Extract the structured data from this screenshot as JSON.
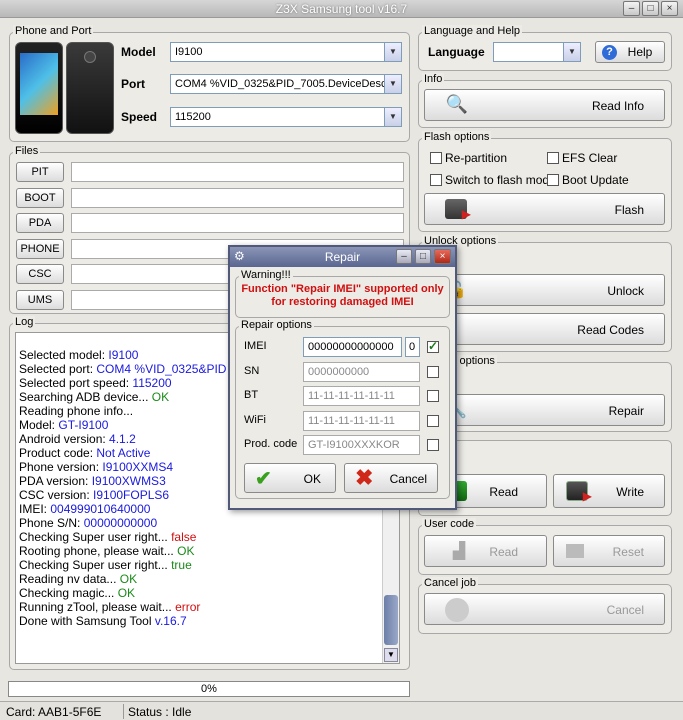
{
  "window": {
    "title": "Z3X Samsung tool v16.7"
  },
  "phone_port": {
    "title": "Phone and Port",
    "model_label": "Model",
    "model_value": "I9100",
    "port_label": "Port",
    "port_value": "COM4 %VID_0325&PID_7005.DeviceDesc%",
    "speed_label": "Speed",
    "speed_value": "115200"
  },
  "files": {
    "title": "Files",
    "buttons": [
      "PIT",
      "BOOT",
      "PDA",
      "PHONE",
      "CSC",
      "UMS"
    ]
  },
  "lang": {
    "title": "Language and Help",
    "language_label": "Language",
    "help_label": "Help"
  },
  "info": {
    "title": "Info",
    "read_info": "Read Info"
  },
  "flash": {
    "title": "Flash options",
    "repartition": "Re-partition",
    "efs_clear": "EFS Clear",
    "switch_flash": "Switch to flash mode",
    "boot_update": "Boot Update",
    "flash_button": "Flash"
  },
  "unlock": {
    "title": "Unlock options",
    "unlock_button": "Unlock",
    "read_codes": "Read Codes"
  },
  "repair_opts": {
    "title": "Repair options",
    "repair_button": "Repair"
  },
  "rw": {
    "read": "Read",
    "write": "Write"
  },
  "user_code": {
    "title": "User code",
    "read": "Read",
    "reset": "Reset"
  },
  "cancel_job": {
    "title": "Cancel job",
    "cancel": "Cancel"
  },
  "log": {
    "title": "Log",
    "lines": [
      [
        [
          "Selected model: ",
          ""
        ],
        [
          "I9100",
          "blue"
        ]
      ],
      [
        [
          "Selected port: ",
          ""
        ],
        [
          "COM4 %VID_0325&PID",
          "blue"
        ]
      ],
      [
        [
          "Selected port speed: ",
          ""
        ],
        [
          "115200",
          "blue"
        ]
      ],
      [
        [
          "Searching ADB device... ",
          ""
        ],
        [
          "OK",
          "green"
        ]
      ],
      [
        [
          "Reading phone info...",
          ""
        ]
      ],
      [
        [
          "Model: ",
          ""
        ],
        [
          "GT-I9100",
          "blue"
        ]
      ],
      [
        [
          "Android version: ",
          ""
        ],
        [
          "4.1.2",
          "blue"
        ]
      ],
      [
        [
          "Product code: ",
          ""
        ],
        [
          "Not Active",
          "blue"
        ]
      ],
      [
        [
          "Phone version: ",
          ""
        ],
        [
          "I9100XXMS4",
          "blue"
        ]
      ],
      [
        [
          "PDA version: ",
          ""
        ],
        [
          "I9100XWMS3",
          "blue"
        ]
      ],
      [
        [
          "CSC version: ",
          ""
        ],
        [
          "I9100FOPLS6",
          "blue"
        ]
      ],
      [
        [
          "IMEI: ",
          ""
        ],
        [
          "004999010640000",
          "blue"
        ]
      ],
      [
        [
          "Phone S/N: ",
          ""
        ],
        [
          "00000000000",
          "blue"
        ]
      ],
      [
        [
          "Checking Super user right... ",
          ""
        ],
        [
          "false",
          "red"
        ]
      ],
      [
        [
          "Rooting phone, please wait... ",
          ""
        ],
        [
          "OK",
          "green"
        ]
      ],
      [
        [
          "Checking Super user right... ",
          ""
        ],
        [
          "true",
          "green"
        ]
      ],
      [
        [
          "Reading nv data... ",
          ""
        ],
        [
          "OK",
          "green"
        ]
      ],
      [
        [
          "Checking magic... ",
          ""
        ],
        [
          "OK",
          "green"
        ]
      ],
      [
        [
          "Running zTool, please wait... ",
          ""
        ],
        [
          "error",
          "red"
        ]
      ],
      [
        [
          "Done with Samsung Tool ",
          ""
        ],
        [
          "v.16.7",
          "blue"
        ]
      ]
    ]
  },
  "progress": {
    "text": "0%",
    "value": 0
  },
  "status": {
    "card": "Card: AAB1-5F6E",
    "status": "Status : Idle"
  },
  "dialog": {
    "title": "Repair",
    "warning_title": "Warning!!!",
    "warning_text": "Function \"Repair IMEI\" supported only for restoring damaged IMEI",
    "options_title": "Repair options",
    "imei_label": "IMEI",
    "imei_value": "00000000000000",
    "imei_check": "0",
    "sn_label": "SN",
    "sn_value": "0000000000",
    "bt_label": "BT",
    "bt_value": "11-11-11-11-11-11",
    "wifi_label": "WiFi",
    "wifi_value": "11-11-11-11-11-11",
    "prod_label": "Prod. code",
    "prod_value": "GT-I9100XXXKOR",
    "ok": "OK",
    "cancel": "Cancel"
  }
}
